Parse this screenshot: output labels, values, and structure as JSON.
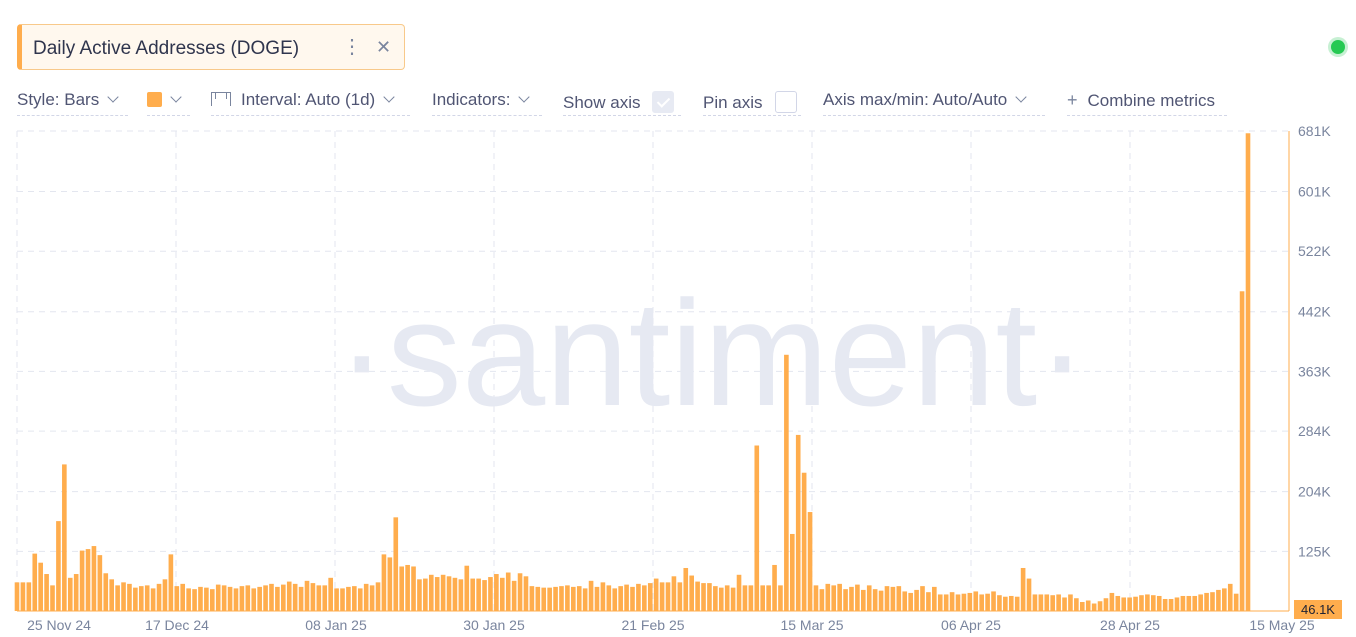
{
  "metric": {
    "title": "Daily Active Addresses (DOGE)",
    "menu_icon": "⋮",
    "close_icon": "✕"
  },
  "toolbar": {
    "style_label": "Style: Bars",
    "interval_label": "Interval: Auto (1d)",
    "indicators_label": "Indicators:",
    "show_axis_label": "Show axis",
    "show_axis_checked": true,
    "pin_axis_label": "Pin axis",
    "pin_axis_checked": false,
    "axis_maxmin_label": "Axis max/min: Auto/Auto",
    "combine_label": "Combine metrics",
    "color": "#ffad4d"
  },
  "status": {
    "color": "#26c953"
  },
  "watermark": "·santiment·",
  "chart_data": {
    "type": "bar",
    "color": "#ffad4d",
    "x_tick_labels": [
      "25 Nov 24",
      "17 Dec 24",
      "08 Jan 25",
      "30 Jan 25",
      "21 Feb 25",
      "15 Mar 25",
      "06 Apr 25",
      "28 Apr 25",
      "15 May 25"
    ],
    "y_tick_labels": [
      "681K",
      "601K",
      "522K",
      "442K",
      "363K",
      "284K",
      "204K",
      "125K"
    ],
    "y_ticks": [
      681,
      601,
      522,
      442,
      363,
      284,
      204,
      125
    ],
    "current_value_label": "46.1K",
    "ylim": [
      46.1,
      681
    ],
    "y_unit": "K",
    "grid": true,
    "values": [
      84,
      84,
      84,
      122,
      110,
      95,
      80,
      165,
      240,
      90,
      95,
      126,
      128,
      132,
      120,
      96,
      88,
      80,
      84,
      82,
      77,
      79,
      80,
      76,
      82,
      88,
      121,
      79,
      82,
      76,
      75,
      78,
      77,
      75,
      81,
      80,
      78,
      76,
      79,
      80,
      76,
      78,
      80,
      82,
      78,
      81,
      85,
      82,
      78,
      86,
      83,
      80,
      80,
      90,
      76,
      76,
      78,
      79,
      76,
      82,
      80,
      84,
      121,
      117,
      170,
      105,
      107,
      105,
      88,
      89,
      94,
      91,
      94,
      92,
      90,
      88,
      106,
      89,
      89,
      87,
      91,
      95,
      90,
      97,
      86,
      96,
      92,
      79,
      78,
      77,
      77,
      78,
      79,
      80,
      78,
      79,
      76,
      86,
      78,
      84,
      80,
      76,
      79,
      81,
      78,
      82,
      80,
      83,
      89,
      84,
      84,
      92,
      84,
      103,
      93,
      85,
      83,
      83,
      79,
      77,
      80,
      77,
      94,
      80,
      80,
      265,
      80,
      80,
      107,
      80,
      385,
      148,
      279,
      229,
      177,
      80,
      75,
      82,
      80,
      82,
      75,
      78,
      81,
      74,
      80,
      75,
      73,
      79,
      78,
      79,
      72,
      70,
      74,
      79,
      71,
      78,
      68,
      68,
      71,
      68,
      69,
      70,
      72,
      68,
      69,
      72,
      67,
      65,
      66,
      65,
      103,
      89,
      68,
      68,
      68,
      67,
      68,
      64,
      68,
      63,
      58,
      60,
      56,
      59,
      63,
      70,
      66,
      64,
      64,
      65,
      67,
      68,
      67,
      66,
      62,
      62,
      64,
      66,
      66,
      66,
      68,
      70,
      71,
      74,
      76,
      82,
      69,
      469,
      678
    ]
  }
}
